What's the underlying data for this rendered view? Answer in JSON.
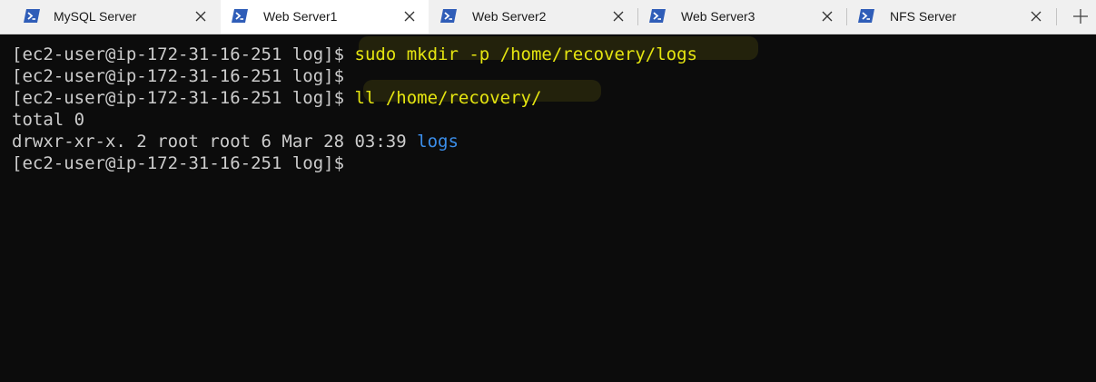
{
  "tabs": [
    {
      "label": "MySQL Server",
      "icon": "powershell-icon",
      "active": false
    },
    {
      "label": "Web Server1",
      "icon": "powershell-icon",
      "active": true
    },
    {
      "label": "Web Server2",
      "icon": "powershell-icon",
      "active": false
    },
    {
      "label": "Web Server3",
      "icon": "powershell-icon",
      "active": false
    },
    {
      "label": "NFS Server",
      "icon": "powershell-icon",
      "active": false
    }
  ],
  "new_tab_icon": "plus-icon",
  "terminal": {
    "lines": [
      {
        "prompt": "[ec2-user@ip-172-31-16-251 log]$ ",
        "command": "sudo mkdir -p /home/recovery/logs"
      },
      {
        "prompt": "[ec2-user@ip-172-31-16-251 log]$",
        "command": ""
      },
      {
        "prompt": "[ec2-user@ip-172-31-16-251 log]$ ",
        "command": "ll /home/recovery/"
      },
      {
        "output": "total 0"
      },
      {
        "output": "drwxr-xr-x. 2 root root 6 Mar 28 03:39 ",
        "dir": "logs"
      },
      {
        "prompt": "[ec2-user@ip-172-31-16-251 log]$",
        "command": ""
      }
    ]
  },
  "colors": {
    "terminal_bg": "#0c0c0c",
    "terminal_text": "#cccccc",
    "command_text": "#e5e510",
    "directory_text": "#3b8eea",
    "tab_bar_bg": "#f0f0f0",
    "active_tab_bg": "#ffffff",
    "powershell_icon": "#2f5db8"
  }
}
